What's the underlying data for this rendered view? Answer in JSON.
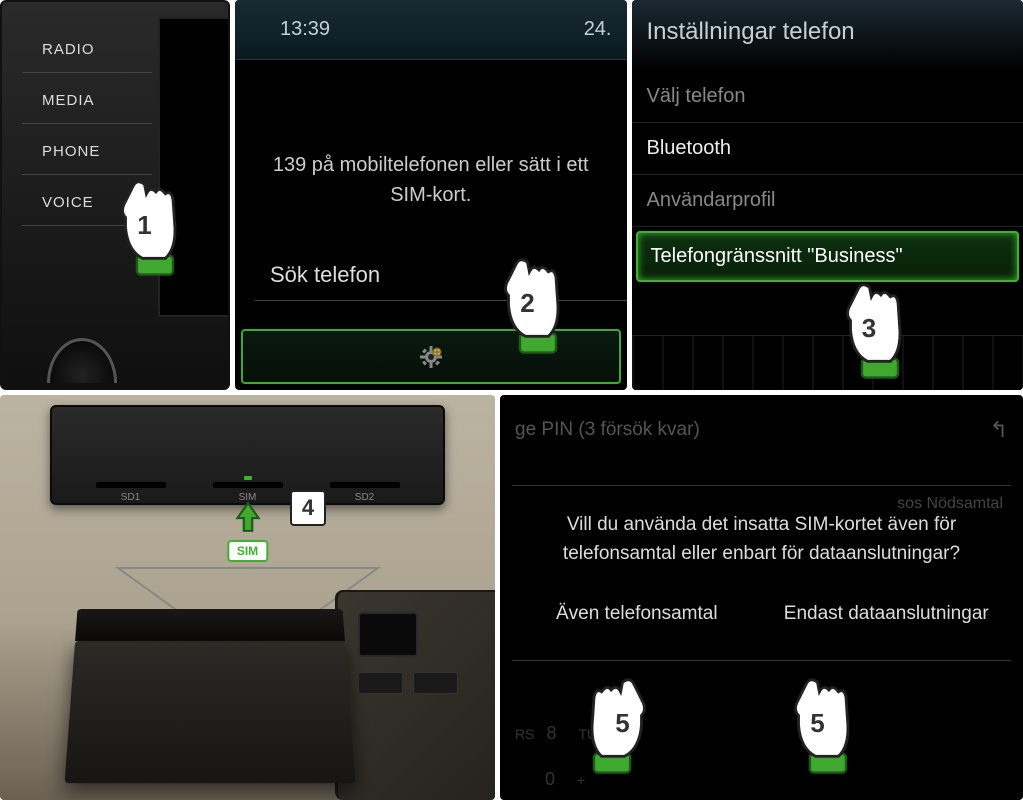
{
  "panel1": {
    "buttons": [
      "RADIO",
      "MEDIA",
      "PHONE",
      "VOICE"
    ]
  },
  "panel2": {
    "time": "13:39",
    "temp": "24.",
    "message_line1": "139 på mobiltelefonen eller sätt i ett",
    "message_line2": "SIM-kort.",
    "search_label": "Sök telefon"
  },
  "panel3": {
    "title": "Inställningar telefon",
    "items": [
      {
        "label": "Välj telefon",
        "state": "dim"
      },
      {
        "label": "Bluetooth",
        "state": "active"
      },
      {
        "label": "Användarprofil",
        "state": "dim"
      },
      {
        "label": "Telefongränssnitt \"Business\"",
        "state": "highlight"
      }
    ]
  },
  "panel4": {
    "slots": {
      "sd1": "SD1",
      "sim": "SIM",
      "sd2": "SD2"
    },
    "sim_badge": "SIM"
  },
  "panel5": {
    "header": "ge PIN (3 försök kvar)",
    "sos": "sos   Nödsamtal",
    "question_line1": "Vill du använda det insatta SIM-kortet även för",
    "question_line2": "telefonsamtal eller enbart för dataanslutningar?",
    "btn_left": "Även telefonsamtal",
    "btn_right": "Endast dataanslutningar",
    "keypad": {
      "row1_num": "8",
      "row1_txt": "TUV",
      "row2_num": "0",
      "row2_txt": "+"
    },
    "keypad_prefix": "RS"
  },
  "steps": {
    "s1": "1",
    "s2": "2",
    "s3": "3",
    "s4": "4",
    "s5a": "5",
    "s5b": "5"
  }
}
